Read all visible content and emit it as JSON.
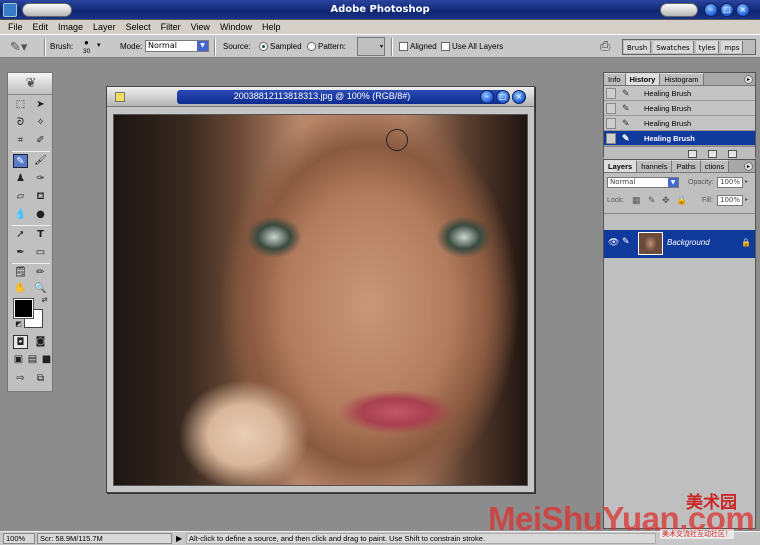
{
  "app": {
    "title": "Adobe Photoshop"
  },
  "menu": [
    "File",
    "Edit",
    "Image",
    "Layer",
    "Select",
    "Filter",
    "View",
    "Window",
    "Help"
  ],
  "options": {
    "brush_label": "Brush:",
    "brush_size": "30",
    "mode_label": "Mode:",
    "mode_value": "Normal",
    "source_label": "Source:",
    "sampled_label": "Sampled",
    "pattern_label": "Pattern:",
    "sampled_selected": true,
    "aligned_label": "Aligned",
    "aligned_checked": false,
    "use_all_layers_label": "Use All Layers",
    "use_all_layers_checked": false
  },
  "palette_well": [
    "Brush",
    "Swatches",
    "tyles",
    "mps"
  ],
  "document": {
    "title": "20038812113818313.jpg @ 100% (RGB/8#)"
  },
  "history_palette": {
    "tabs": [
      "Info",
      "History",
      "Histogram"
    ],
    "active_tab": "History",
    "items": [
      "Healing Brush",
      "Healing Brush",
      "Healing Brush",
      "Healing Brush"
    ],
    "current_index": 3
  },
  "layers_palette": {
    "tabs": [
      "Layers",
      "hannels",
      "Paths",
      "ctions"
    ],
    "active_tab": "Layers",
    "blend_mode": "Normal",
    "opacity_label": "Opacity:",
    "opacity_value": "100%",
    "lock_label": "Lock:",
    "fill_label": "Fill:",
    "fill_value": "100%",
    "layers": [
      {
        "name": "Background"
      }
    ]
  },
  "status": {
    "zoom": "100%",
    "scratch": "Scr: 58.9M/115.7M",
    "hint": "Alt-click to define a source, and then click and drag to paint. Use Shift to constrain stroke."
  },
  "watermark": {
    "cn_title": "美术园",
    "latin": "MeiShuYuan.com",
    "sub": "美术交流社互动社区！"
  },
  "colors": {
    "foreground": "#000000",
    "background": "#ffffff",
    "title_bar": "#0e2672",
    "selection": "#10399c"
  }
}
